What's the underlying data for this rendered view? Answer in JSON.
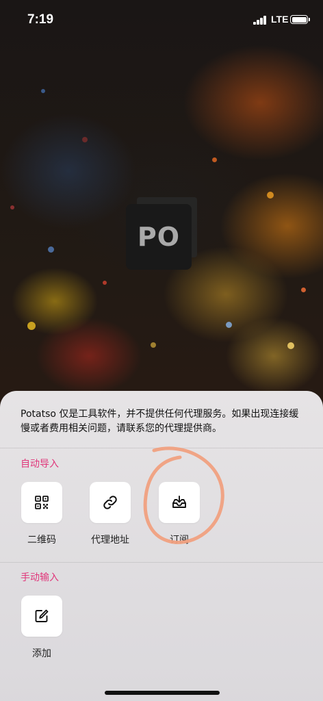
{
  "status_bar": {
    "time": "7:19",
    "network": "LTE"
  },
  "app_logo": {
    "text": "PO"
  },
  "sheet": {
    "notice": "Potatso 仅是工具软件，并不提供任何代理服务。如果出现连接缓慢或者费用相关问题，请联系您的代理提供商。",
    "auto_import": {
      "title": "自动导入",
      "items": [
        {
          "label": "二维码",
          "icon": "qr-code-icon"
        },
        {
          "label": "代理地址",
          "icon": "link-icon"
        },
        {
          "label": "订阅",
          "icon": "inbox-download-icon"
        }
      ]
    },
    "manual_input": {
      "title": "手动输入",
      "items": [
        {
          "label": "添加",
          "icon": "edit-icon"
        }
      ]
    }
  },
  "colors": {
    "section_title": "#e0367a",
    "annotation_circle": "#f0a080",
    "sheet_bg": "#e8e6e8"
  }
}
